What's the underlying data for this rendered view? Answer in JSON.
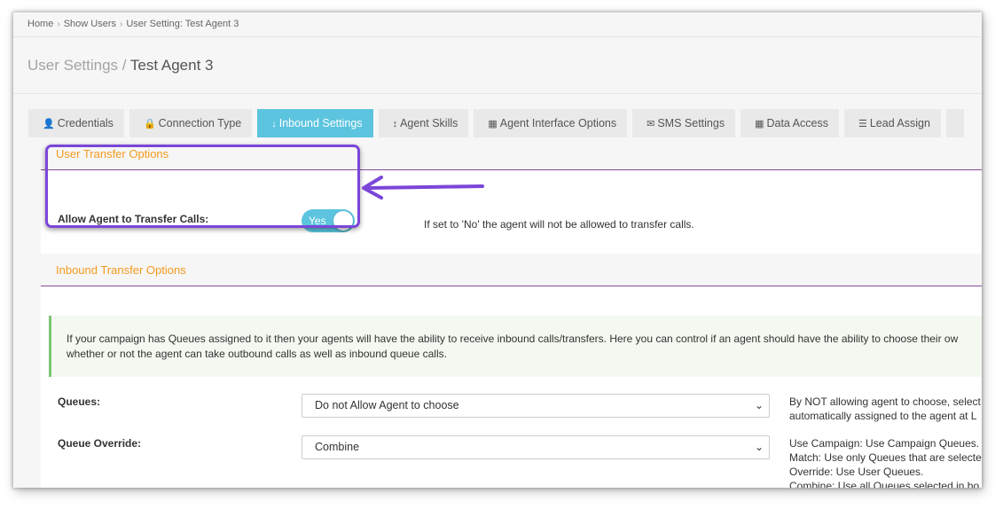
{
  "breadcrumb": {
    "home": "Home",
    "show_users": "Show Users",
    "current": "User Setting: Test Agent 3",
    "separator": "›"
  },
  "page_title": {
    "prefix": "User Settings /",
    "name": "Test Agent 3"
  },
  "tabs": [
    {
      "label": "Credentials",
      "icon": "user-icon",
      "glyph": "👤",
      "active": false
    },
    {
      "label": "Connection Type",
      "icon": "lock-icon",
      "glyph": "🔒",
      "active": false
    },
    {
      "label": "Inbound Settings",
      "icon": "arrow-down-icon",
      "glyph": "↓",
      "active": true
    },
    {
      "label": "Agent Skills",
      "icon": "arrows-vertical-icon",
      "glyph": "↕",
      "active": false
    },
    {
      "label": "Agent Interface Options",
      "icon": "grid-icon",
      "glyph": "▦",
      "active": false
    },
    {
      "label": "SMS Settings",
      "icon": "envelope-icon",
      "glyph": "✉",
      "active": false
    },
    {
      "label": "Data Access",
      "icon": "grid-icon",
      "glyph": "▦",
      "active": false
    },
    {
      "label": "Lead Assign",
      "icon": "list-ol-icon",
      "glyph": "☰",
      "active": false
    }
  ],
  "user_transfer": {
    "heading": "User Transfer Options",
    "label": "Allow Agent to Transfer Calls:",
    "toggle_value": "Yes",
    "help": "If set to 'No' the agent will not be allowed to transfer calls."
  },
  "inbound_transfer": {
    "heading": "Inbound Transfer Options",
    "info_line1": "If your campaign has Queues assigned to it then your agents will have the ability to receive inbound calls/transfers. Here you can control if an agent should have the ability to choose their ow",
    "info_line2": "whether or not the agent can take outbound calls as well as inbound queue calls."
  },
  "queues": {
    "label": "Queues:",
    "value": "Do not Allow Agent to choose",
    "help_line1": "By NOT allowing agent to choose, select",
    "help_line2": "automatically assigned to the agent at L"
  },
  "queue_override": {
    "label": "Queue Override:",
    "value": "Combine",
    "help_line1": "Use Campaign: Use Campaign Queues.",
    "help_line2": "Match: Use only Queues that are selecte",
    "help_line3": "Override: Use User Queues.",
    "help_line4": "Combine: Use all Queues selected in bo"
  },
  "colors": {
    "accent": "#5cc4de",
    "section_heading": "#f39a1e",
    "divider": "#8a4a9b",
    "callout": "#7b46d8",
    "info_border": "#7cc576"
  }
}
